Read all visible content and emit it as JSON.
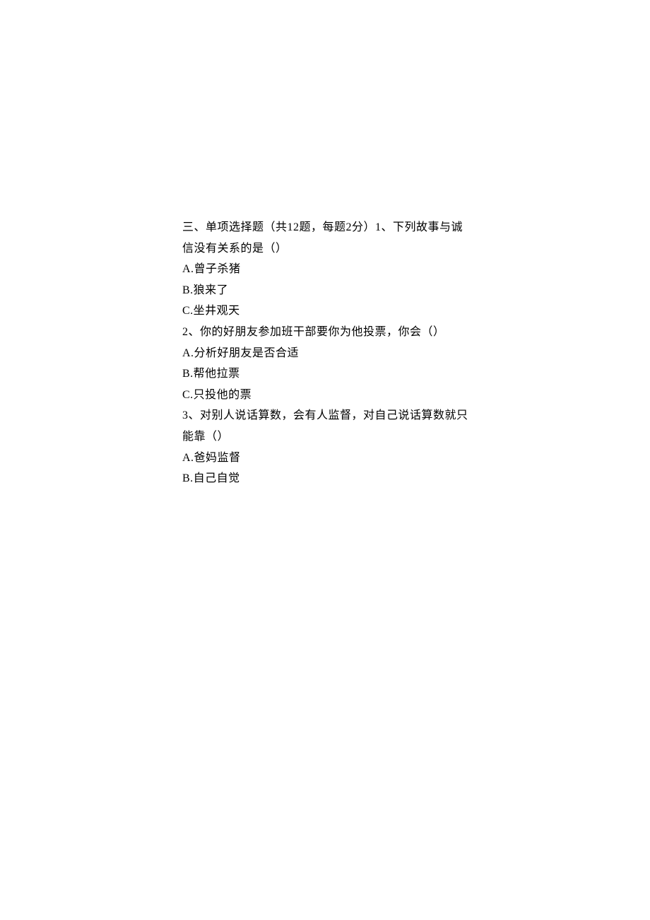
{
  "sectionHeader": "三、单项选择题（共12题，每题2分）1、下列故事与诚信没有关系的是（）",
  "q1": {
    "optA": "A.曾子杀猪",
    "optB": "B.狼来了",
    "optC": "C.坐井观天"
  },
  "q2": {
    "stem": "2、你的好朋友参加班干部要你为他投票，你会（）",
    "optA": "A.分析好朋友是否合适",
    "optB": "B.帮他拉票",
    "optC": "C.只投他的票"
  },
  "q3": {
    "stem": "3、对别人说话算数，会有人监督，对自己说话算数就只能靠（）",
    "optA": "A.爸妈监督",
    "optB": "B.自己自觉"
  }
}
